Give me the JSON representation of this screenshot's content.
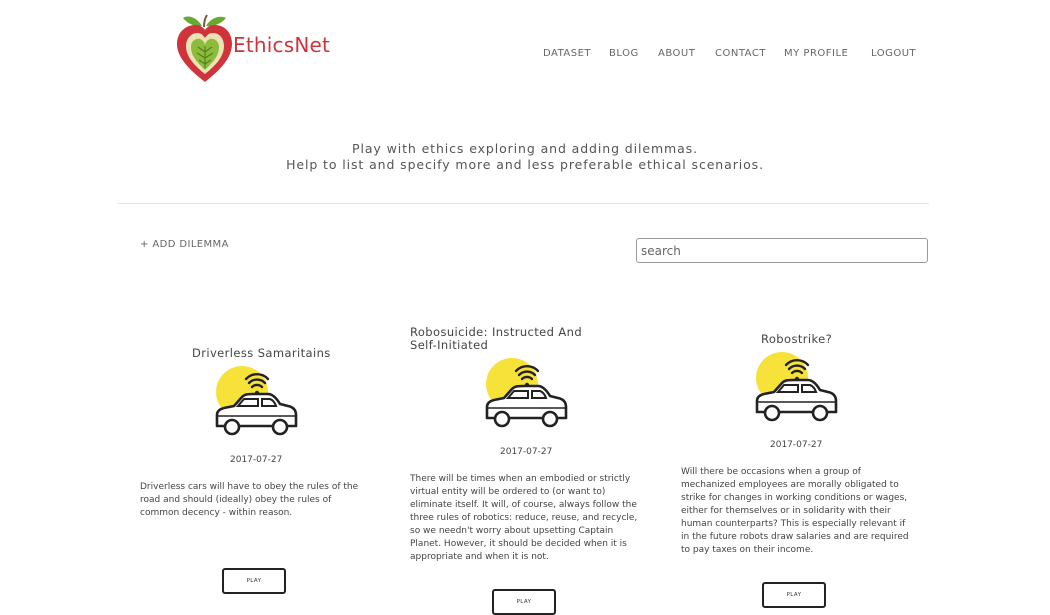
{
  "brand": {
    "name": "EthicsNet",
    "colors": {
      "red": "#d0343a",
      "leaf": "#6aa830",
      "sun": "#f7e23a"
    }
  },
  "nav": {
    "items": [
      "DATASET",
      "BLOG",
      "ABOUT",
      "CONTACT",
      "MY PROFILE",
      "LOGOUT"
    ]
  },
  "tagline": {
    "line1": "Play with ethics exploring and adding dilemmas.",
    "line2": "Help to list and specify more and less preferable ethical scenarios."
  },
  "toolbar": {
    "add_label": "+ ADD DILEMMA",
    "search_placeholder": "search"
  },
  "cards": [
    {
      "title": "Driverless Samaritains",
      "icon": "wifi-car-icon",
      "date": "2017-07-27",
      "description": "Driverless cars will have to obey the rules of the road and should (ideally) obey the rules of common decency - within reason.",
      "play_label": "PLAY"
    },
    {
      "title": "Robosuicide: Instructed And Self-Initiated",
      "icon": "wifi-car-icon",
      "date": "2017-07-27",
      "description": "There will be times when an embodied or strictly virtual entity will be ordered to (or want to) eliminate itself. It will, of course, always follow the three rules of robotics: reduce, reuse, and recycle, so we needn't worry about upsetting Captain Planet. However, it should be decided when it is appropriate and when it is not.",
      "play_label": "PLAY"
    },
    {
      "title": "Robostrike?",
      "icon": "wifi-car-icon",
      "date": "2017-07-27",
      "description": "Will there be occasions when a group of mechanized employees are morally obligated to strike for changes in working conditions or wages, either for themselves or in solidarity with their human counterparts? This is especially relevant if in the future robots draw salaries and are required to pay taxes on their income.",
      "play_label": "PLAY"
    }
  ]
}
